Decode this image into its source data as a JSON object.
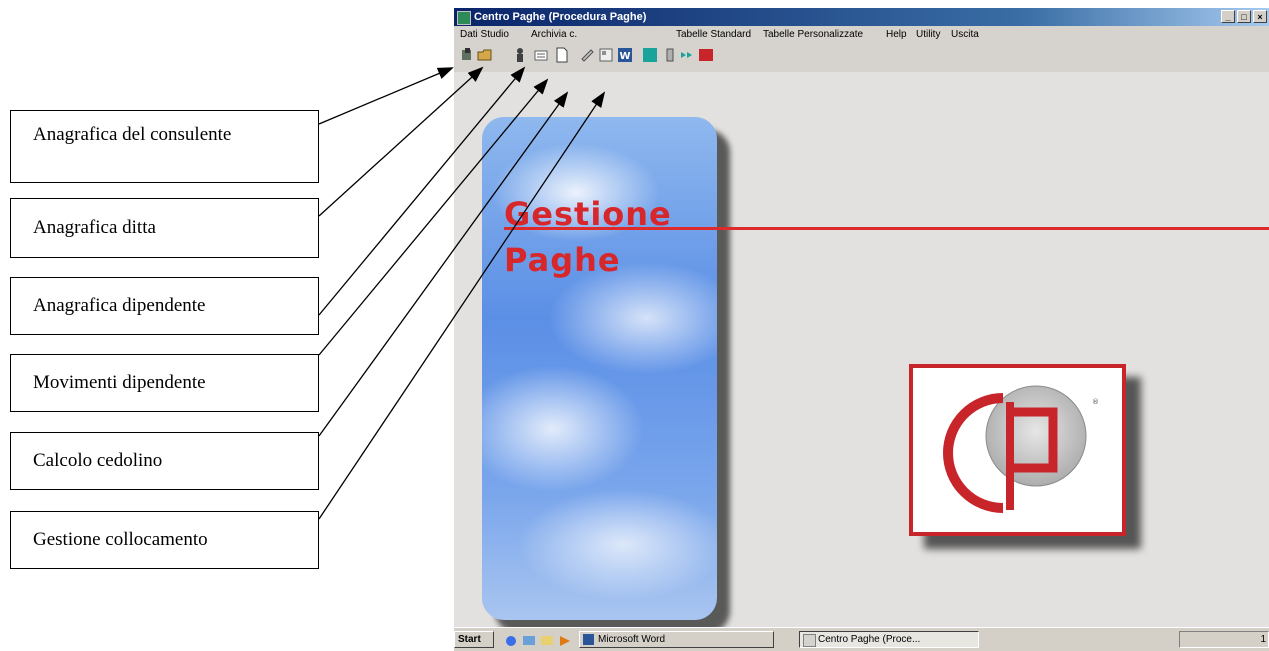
{
  "callouts": [
    "Anagrafica del consulente",
    "Anagrafica ditta",
    "Anagrafica dipendente",
    "Movimenti dipendente",
    "Calcolo cedolino",
    "Gestione collocamento"
  ],
  "window": {
    "title": "Centro Paghe (Procedura Paghe)",
    "min_label": "_",
    "max_label": "□",
    "close_label": "×"
  },
  "menu": {
    "dati_studio": "Dati Studio",
    "archivia": "Archivia c.",
    "disabled": "",
    "tabelle_standard": "Tabelle Standard",
    "tabelle_personalizzate": "Tabelle Personalizzate",
    "help": "Help",
    "utility": "Utility",
    "uscita": "Uscita"
  },
  "banner": {
    "line1": "Gestione",
    "line2": "Paghe"
  },
  "taskbar": {
    "start": "Start",
    "word": "Microsoft Word",
    "app": "Centro Paghe (Proce...",
    "clock": "1"
  },
  "colors": {
    "accent_red": "#d8272a",
    "title_blue": "#0a246a"
  }
}
